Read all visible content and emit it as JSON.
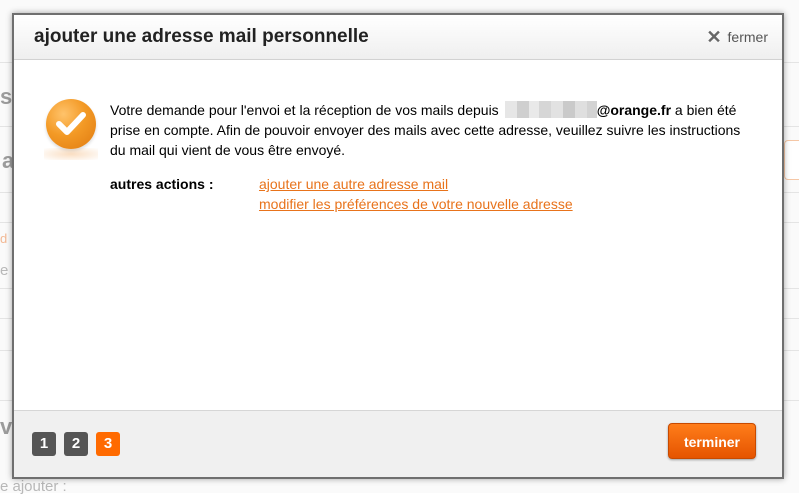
{
  "background": {
    "fragments": [
      "s",
      "a",
      "d",
      "e",
      "v",
      "e ajouter :"
    ]
  },
  "dialog": {
    "title": "ajouter une adresse mail personnelle",
    "close_label": "fermer",
    "message": {
      "before": "Votre demande pour l'envoi et la réception de vos mails depuis",
      "domain": "@orange.fr",
      "after": " a bien été prise en compte. Afin de pouvoir envoyer des mails avec cette adresse, veuillez suivre les instructions du mail qui vient de vous être envoyé."
    },
    "actions_label": "autres actions :",
    "links": [
      "ajouter une autre adresse mail",
      "modifier les préférences de votre nouvelle adresse"
    ]
  },
  "footer": {
    "steps": [
      "1",
      "2",
      "3"
    ],
    "active_step": "3",
    "finish_label": "terminer"
  },
  "icons": {
    "success": "checkmark-circle-icon",
    "close": "close-icon"
  },
  "colors": {
    "accent": "#ff6a00",
    "link": "#e8731b",
    "step_inactive": "#555555"
  }
}
